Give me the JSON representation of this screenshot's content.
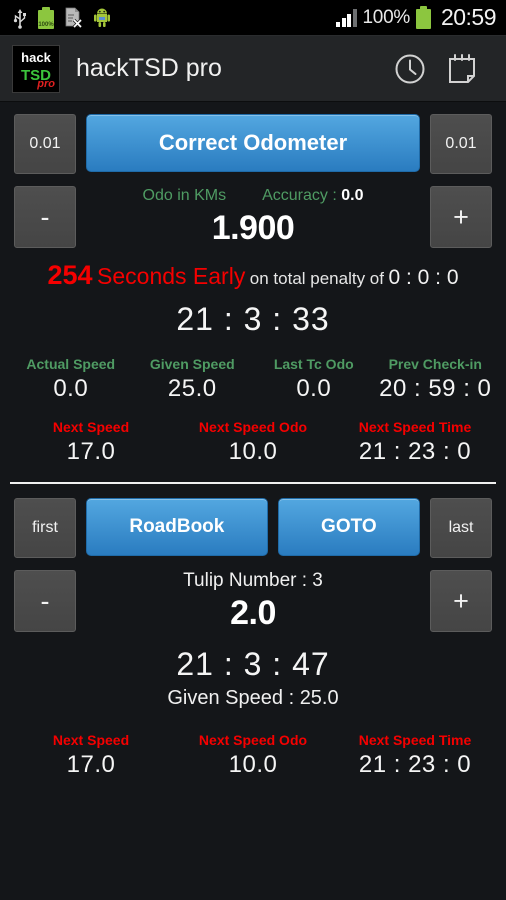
{
  "status_bar": {
    "icons": [
      "usb-icon",
      "battery-charge-icon",
      "document-error-icon",
      "android-robot-icon"
    ],
    "battery_small_percent": "100%",
    "signal_icon": "signal-bars-icon",
    "battery_percent": "100%",
    "battery_icon": "battery-full-icon",
    "clock": "20:59"
  },
  "action_bar": {
    "logo": {
      "line1": "hack",
      "line2": "TSD",
      "line3": "pro"
    },
    "title": "hackTSD pro",
    "actions": [
      {
        "name": "clock-icon",
        "label": "Clock"
      },
      {
        "name": "calendar-icon",
        "label": "Calendar"
      }
    ]
  },
  "odometer": {
    "left_step_button": "0.01",
    "right_step_button": "0.01",
    "correct_button": "Correct Odometer",
    "minus_button": "-",
    "plus_button": "+",
    "unit_label": "Odo in KMs",
    "accuracy_label": "Accuracy :",
    "accuracy_value": "0.0",
    "value": "1.900"
  },
  "penalty": {
    "seconds": "254",
    "early_text": "Seconds Early",
    "on_total_text": "on total penalty of",
    "total_penalty": "0 : 0 : 0",
    "clock": "21 : 3 : 33"
  },
  "speed_grid": {
    "columns": [
      {
        "label": "Actual Speed",
        "value": "0.0"
      },
      {
        "label": "Given Speed",
        "value": "25.0"
      },
      {
        "label": "Last Tc Odo",
        "value": "0.0"
      },
      {
        "label": "Prev Check-in",
        "value": "20 : 59 : 0"
      }
    ],
    "next": [
      {
        "label": "Next Speed",
        "value": "17.0"
      },
      {
        "label": "Next Speed Odo",
        "value": "10.0"
      },
      {
        "label": "Next Speed Time",
        "value": "21 : 23 : 0"
      }
    ]
  },
  "roadbook": {
    "first_button": "first",
    "last_button": "last",
    "roadbook_button": "RoadBook",
    "goto_button": "GOTO",
    "minus_button": "-",
    "plus_button": "+",
    "tulip_label": "Tulip Number : 3",
    "tulip_value": "2.0",
    "clock": "21 : 3 : 47",
    "given_speed_label": "Given Speed :",
    "given_speed_value": "25.0",
    "next": [
      {
        "label": "Next Speed",
        "value": "17.0"
      },
      {
        "label": "Next Speed Odo",
        "value": "10.0"
      },
      {
        "label": "Next Speed Time",
        "value": "21 : 23 : 0"
      }
    ]
  },
  "colors": {
    "accent_blue": "#3d8fd0",
    "label_green": "#4f9b63",
    "alert_red": "#f50000",
    "background": "#141619",
    "action_bar": "#232527"
  }
}
